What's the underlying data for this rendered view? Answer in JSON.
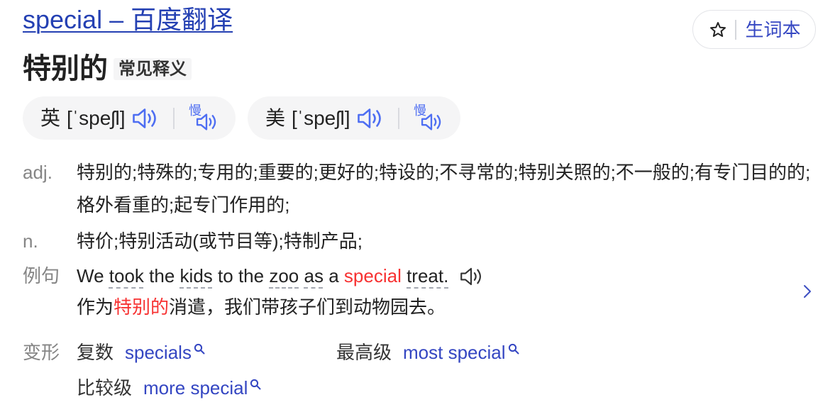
{
  "title": "special – 百度翻译",
  "wordbook_button": {
    "label": "生词本",
    "icon": "star-outline-icon"
  },
  "headword": {
    "translation": "特别的",
    "badge": "常见释义"
  },
  "phonetics": [
    {
      "region": "英",
      "ipa": "[ˈspeʃl]",
      "play_icon": "speaker-icon",
      "slow_label": "慢",
      "slow_icon": "slow-speaker-icon"
    },
    {
      "region": "美",
      "ipa": "[ˈspeʃl]",
      "play_icon": "speaker-icon",
      "slow_label": "慢",
      "slow_icon": "slow-speaker-icon"
    }
  ],
  "definitions": [
    {
      "pos": "adj.",
      "meaning": "特别的;特殊的;专用的;重要的;更好的;特设的;不寻常的;特别关照的;不一般的;有专门目的的;格外看重的;起专门作用的;"
    },
    {
      "pos": "n.",
      "meaning": "特价;特别活动(或节目等);特制产品;"
    }
  ],
  "example": {
    "label": "例句",
    "en": [
      {
        "text": "We"
      },
      {
        "text": "took",
        "dashed_underline": true
      },
      {
        "text": "the"
      },
      {
        "text": "kids",
        "dashed_underline": true
      },
      {
        "text": "to"
      },
      {
        "text": "the"
      },
      {
        "text": "zoo",
        "dashed_underline": true
      },
      {
        "text": "as",
        "dashed_underline": true
      },
      {
        "text": "a"
      },
      {
        "text": "special",
        "highlight": true
      },
      {
        "text": "treat.",
        "dashed_underline": true
      }
    ],
    "zh": [
      {
        "text": "作为"
      },
      {
        "text": "特别的",
        "highlight": true
      },
      {
        "text": "消遣，我们带孩子们到动物园去。"
      }
    ],
    "play_icon": "speaker-icon",
    "more_icon": "chevron-right-icon"
  },
  "forms": {
    "label": "变形",
    "search_icon": "search-icon",
    "items": [
      {
        "type": "复数",
        "word": "specials"
      },
      {
        "type": "最高级",
        "word": "most special"
      },
      {
        "type": "比较级",
        "word": "more special"
      }
    ]
  },
  "colors": {
    "link_blue": "#2440b3",
    "action_blue": "#3446c2",
    "icon_blue": "#4e6ef2",
    "highlight_red": "#f73131",
    "label_gray": "#858585",
    "text": "#222222",
    "pill_bg": "#f5f5f6"
  }
}
